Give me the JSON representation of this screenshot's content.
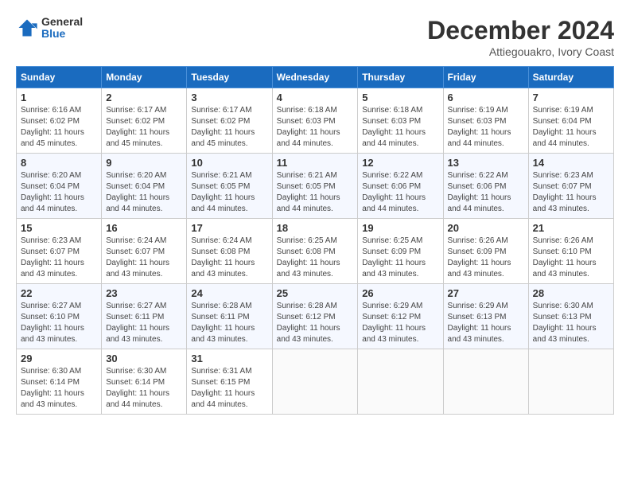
{
  "logo": {
    "general": "General",
    "blue": "Blue"
  },
  "title": "December 2024",
  "subtitle": "Attiegouakro, Ivory Coast",
  "days_of_week": [
    "Sunday",
    "Monday",
    "Tuesday",
    "Wednesday",
    "Thursday",
    "Friday",
    "Saturday"
  ],
  "weeks": [
    [
      {
        "day": "1",
        "sunrise": "6:16 AM",
        "sunset": "6:02 PM",
        "daylight": "11 hours and 45 minutes."
      },
      {
        "day": "2",
        "sunrise": "6:17 AM",
        "sunset": "6:02 PM",
        "daylight": "11 hours and 45 minutes."
      },
      {
        "day": "3",
        "sunrise": "6:17 AM",
        "sunset": "6:02 PM",
        "daylight": "11 hours and 45 minutes."
      },
      {
        "day": "4",
        "sunrise": "6:18 AM",
        "sunset": "6:03 PM",
        "daylight": "11 hours and 44 minutes."
      },
      {
        "day": "5",
        "sunrise": "6:18 AM",
        "sunset": "6:03 PM",
        "daylight": "11 hours and 44 minutes."
      },
      {
        "day": "6",
        "sunrise": "6:19 AM",
        "sunset": "6:03 PM",
        "daylight": "11 hours and 44 minutes."
      },
      {
        "day": "7",
        "sunrise": "6:19 AM",
        "sunset": "6:04 PM",
        "daylight": "11 hours and 44 minutes."
      }
    ],
    [
      {
        "day": "8",
        "sunrise": "6:20 AM",
        "sunset": "6:04 PM",
        "daylight": "11 hours and 44 minutes."
      },
      {
        "day": "9",
        "sunrise": "6:20 AM",
        "sunset": "6:04 PM",
        "daylight": "11 hours and 44 minutes."
      },
      {
        "day": "10",
        "sunrise": "6:21 AM",
        "sunset": "6:05 PM",
        "daylight": "11 hours and 44 minutes."
      },
      {
        "day": "11",
        "sunrise": "6:21 AM",
        "sunset": "6:05 PM",
        "daylight": "11 hours and 44 minutes."
      },
      {
        "day": "12",
        "sunrise": "6:22 AM",
        "sunset": "6:06 PM",
        "daylight": "11 hours and 44 minutes."
      },
      {
        "day": "13",
        "sunrise": "6:22 AM",
        "sunset": "6:06 PM",
        "daylight": "11 hours and 44 minutes."
      },
      {
        "day": "14",
        "sunrise": "6:23 AM",
        "sunset": "6:07 PM",
        "daylight": "11 hours and 43 minutes."
      }
    ],
    [
      {
        "day": "15",
        "sunrise": "6:23 AM",
        "sunset": "6:07 PM",
        "daylight": "11 hours and 43 minutes."
      },
      {
        "day": "16",
        "sunrise": "6:24 AM",
        "sunset": "6:07 PM",
        "daylight": "11 hours and 43 minutes."
      },
      {
        "day": "17",
        "sunrise": "6:24 AM",
        "sunset": "6:08 PM",
        "daylight": "11 hours and 43 minutes."
      },
      {
        "day": "18",
        "sunrise": "6:25 AM",
        "sunset": "6:08 PM",
        "daylight": "11 hours and 43 minutes."
      },
      {
        "day": "19",
        "sunrise": "6:25 AM",
        "sunset": "6:09 PM",
        "daylight": "11 hours and 43 minutes."
      },
      {
        "day": "20",
        "sunrise": "6:26 AM",
        "sunset": "6:09 PM",
        "daylight": "11 hours and 43 minutes."
      },
      {
        "day": "21",
        "sunrise": "6:26 AM",
        "sunset": "6:10 PM",
        "daylight": "11 hours and 43 minutes."
      }
    ],
    [
      {
        "day": "22",
        "sunrise": "6:27 AM",
        "sunset": "6:10 PM",
        "daylight": "11 hours and 43 minutes."
      },
      {
        "day": "23",
        "sunrise": "6:27 AM",
        "sunset": "6:11 PM",
        "daylight": "11 hours and 43 minutes."
      },
      {
        "day": "24",
        "sunrise": "6:28 AM",
        "sunset": "6:11 PM",
        "daylight": "11 hours and 43 minutes."
      },
      {
        "day": "25",
        "sunrise": "6:28 AM",
        "sunset": "6:12 PM",
        "daylight": "11 hours and 43 minutes."
      },
      {
        "day": "26",
        "sunrise": "6:29 AM",
        "sunset": "6:12 PM",
        "daylight": "11 hours and 43 minutes."
      },
      {
        "day": "27",
        "sunrise": "6:29 AM",
        "sunset": "6:13 PM",
        "daylight": "11 hours and 43 minutes."
      },
      {
        "day": "28",
        "sunrise": "6:30 AM",
        "sunset": "6:13 PM",
        "daylight": "11 hours and 43 minutes."
      }
    ],
    [
      {
        "day": "29",
        "sunrise": "6:30 AM",
        "sunset": "6:14 PM",
        "daylight": "11 hours and 43 minutes."
      },
      {
        "day": "30",
        "sunrise": "6:30 AM",
        "sunset": "6:14 PM",
        "daylight": "11 hours and 44 minutes."
      },
      {
        "day": "31",
        "sunrise": "6:31 AM",
        "sunset": "6:15 PM",
        "daylight": "11 hours and 44 minutes."
      },
      null,
      null,
      null,
      null
    ]
  ],
  "labels": {
    "sunrise": "Sunrise:",
    "sunset": "Sunset:",
    "daylight": "Daylight:"
  }
}
